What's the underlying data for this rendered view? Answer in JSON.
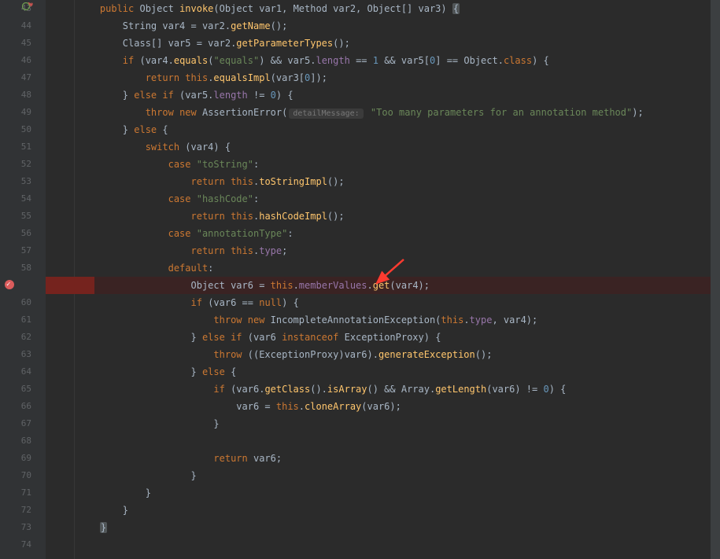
{
  "startLine": 43,
  "breakpointLine": 59,
  "lines": [
    {
      "indent": 1,
      "tokens": [
        {
          "t": "public ",
          "c": "kw"
        },
        {
          "t": "Object ",
          "c": "ty"
        },
        {
          "t": "invoke",
          "c": "fn"
        },
        {
          "t": "(Object var1, Method var2, Object[] var3) ",
          "c": "par"
        },
        {
          "t": "{",
          "c": "op",
          "caret": true
        }
      ]
    },
    {
      "indent": 2,
      "tokens": [
        {
          "t": "String var4 = var2.",
          "c": "par"
        },
        {
          "t": "getName",
          "c": "fn"
        },
        {
          "t": "();",
          "c": "op"
        }
      ]
    },
    {
      "indent": 2,
      "tokens": [
        {
          "t": "Class[] var5 = var2.",
          "c": "par"
        },
        {
          "t": "getParameterTypes",
          "c": "fn"
        },
        {
          "t": "();",
          "c": "op"
        }
      ]
    },
    {
      "indent": 2,
      "tokens": [
        {
          "t": "if ",
          "c": "kw"
        },
        {
          "t": "(var4.",
          "c": "par"
        },
        {
          "t": "equals",
          "c": "fn"
        },
        {
          "t": "(",
          "c": "op"
        },
        {
          "t": "\"equals\"",
          "c": "str"
        },
        {
          "t": ") && var5.",
          "c": "par"
        },
        {
          "t": "length",
          "c": "fld"
        },
        {
          "t": " == ",
          "c": "op"
        },
        {
          "t": "1",
          "c": "num"
        },
        {
          "t": " && var5[",
          "c": "par"
        },
        {
          "t": "0",
          "c": "num"
        },
        {
          "t": "] == Object.",
          "c": "par"
        },
        {
          "t": "class",
          "c": "kw"
        },
        {
          "t": ") {",
          "c": "op"
        }
      ]
    },
    {
      "indent": 3,
      "tokens": [
        {
          "t": "return ",
          "c": "kw"
        },
        {
          "t": "this",
          "c": "kw"
        },
        {
          "t": ".",
          "c": "op"
        },
        {
          "t": "equalsImpl",
          "c": "fn"
        },
        {
          "t": "(var3[",
          "c": "par"
        },
        {
          "t": "0",
          "c": "num"
        },
        {
          "t": "]);",
          "c": "op"
        }
      ]
    },
    {
      "indent": 2,
      "tokens": [
        {
          "t": "} ",
          "c": "op"
        },
        {
          "t": "else if ",
          "c": "kw"
        },
        {
          "t": "(var5.",
          "c": "par"
        },
        {
          "t": "length",
          "c": "fld"
        },
        {
          "t": " != ",
          "c": "op"
        },
        {
          "t": "0",
          "c": "num"
        },
        {
          "t": ") {",
          "c": "op"
        }
      ]
    },
    {
      "indent": 3,
      "tokens": [
        {
          "t": "throw ",
          "c": "kw"
        },
        {
          "t": "new ",
          "c": "kw"
        },
        {
          "t": "AssertionError",
          "c": "ty"
        },
        {
          "t": "(",
          "c": "op"
        },
        {
          "t": "detailMessage:",
          "hint": true
        },
        {
          "t": "\"Too many parameters for an annotation method\"",
          "c": "str"
        },
        {
          "t": ");",
          "c": "op"
        }
      ]
    },
    {
      "indent": 2,
      "tokens": [
        {
          "t": "} ",
          "c": "op"
        },
        {
          "t": "else ",
          "c": "kw"
        },
        {
          "t": "{",
          "c": "op"
        }
      ]
    },
    {
      "indent": 3,
      "tokens": [
        {
          "t": "switch ",
          "c": "kw"
        },
        {
          "t": "(var4) {",
          "c": "par"
        }
      ]
    },
    {
      "indent": 4,
      "tokens": [
        {
          "t": "case ",
          "c": "kw"
        },
        {
          "t": "\"toString\"",
          "c": "str"
        },
        {
          "t": ":",
          "c": "op"
        }
      ]
    },
    {
      "indent": 5,
      "tokens": [
        {
          "t": "return ",
          "c": "kw"
        },
        {
          "t": "this",
          "c": "kw"
        },
        {
          "t": ".",
          "c": "op"
        },
        {
          "t": "toStringImpl",
          "c": "fn"
        },
        {
          "t": "();",
          "c": "op"
        }
      ]
    },
    {
      "indent": 4,
      "tokens": [
        {
          "t": "case ",
          "c": "kw"
        },
        {
          "t": "\"hashCode\"",
          "c": "str"
        },
        {
          "t": ":",
          "c": "op"
        }
      ]
    },
    {
      "indent": 5,
      "tokens": [
        {
          "t": "return ",
          "c": "kw"
        },
        {
          "t": "this",
          "c": "kw"
        },
        {
          "t": ".",
          "c": "op"
        },
        {
          "t": "hashCodeImpl",
          "c": "fn"
        },
        {
          "t": "();",
          "c": "op"
        }
      ]
    },
    {
      "indent": 4,
      "tokens": [
        {
          "t": "case ",
          "c": "kw"
        },
        {
          "t": "\"annotationType\"",
          "c": "str"
        },
        {
          "t": ":",
          "c": "op"
        }
      ]
    },
    {
      "indent": 5,
      "tokens": [
        {
          "t": "return ",
          "c": "kw"
        },
        {
          "t": "this",
          "c": "kw"
        },
        {
          "t": ".",
          "c": "op"
        },
        {
          "t": "type",
          "c": "fld"
        },
        {
          "t": ";",
          "c": "op"
        }
      ]
    },
    {
      "indent": 4,
      "tokens": [
        {
          "t": "default",
          "c": "kw"
        },
        {
          "t": ":",
          "c": "op"
        }
      ]
    },
    {
      "indent": 5,
      "hl": true,
      "tokens": [
        {
          "t": "Object var6 = ",
          "c": "par"
        },
        {
          "t": "this",
          "c": "kw"
        },
        {
          "t": ".",
          "c": "op"
        },
        {
          "t": "memberValues",
          "c": "fld"
        },
        {
          "t": ".",
          "c": "op"
        },
        {
          "t": "get",
          "c": "fn"
        },
        {
          "t": "(var4);",
          "c": "par"
        }
      ]
    },
    {
      "indent": 5,
      "tokens": [
        {
          "t": "if ",
          "c": "kw"
        },
        {
          "t": "(var6 == ",
          "c": "par"
        },
        {
          "t": "null",
          "c": "kw"
        },
        {
          "t": ") {",
          "c": "op"
        }
      ]
    },
    {
      "indent": 6,
      "tokens": [
        {
          "t": "throw ",
          "c": "kw"
        },
        {
          "t": "new ",
          "c": "kw"
        },
        {
          "t": "IncompleteAnnotationException",
          "c": "ty"
        },
        {
          "t": "(",
          "c": "op"
        },
        {
          "t": "this",
          "c": "kw"
        },
        {
          "t": ".",
          "c": "op"
        },
        {
          "t": "type",
          "c": "fld"
        },
        {
          "t": ", var4);",
          "c": "par"
        }
      ]
    },
    {
      "indent": 5,
      "tokens": [
        {
          "t": "} ",
          "c": "op"
        },
        {
          "t": "else if ",
          "c": "kw"
        },
        {
          "t": "(var6 ",
          "c": "par"
        },
        {
          "t": "instanceof ",
          "c": "kw"
        },
        {
          "t": "ExceptionProxy",
          "c": "ty"
        },
        {
          "t": ") {",
          "c": "op"
        }
      ]
    },
    {
      "indent": 6,
      "tokens": [
        {
          "t": "throw ",
          "c": "kw"
        },
        {
          "t": "((",
          "c": "op"
        },
        {
          "t": "ExceptionProxy",
          "c": "ty"
        },
        {
          "t": ")var6).",
          "c": "par"
        },
        {
          "t": "generateException",
          "c": "fn"
        },
        {
          "t": "();",
          "c": "op"
        }
      ]
    },
    {
      "indent": 5,
      "tokens": [
        {
          "t": "} ",
          "c": "op"
        },
        {
          "t": "else ",
          "c": "kw"
        },
        {
          "t": "{",
          "c": "op"
        }
      ]
    },
    {
      "indent": 6,
      "tokens": [
        {
          "t": "if ",
          "c": "kw"
        },
        {
          "t": "(var6.",
          "c": "par"
        },
        {
          "t": "getClass",
          "c": "fn"
        },
        {
          "t": "().",
          "c": "op"
        },
        {
          "t": "isArray",
          "c": "fn"
        },
        {
          "t": "() && Array.",
          "c": "par"
        },
        {
          "t": "getLength",
          "c": "fn"
        },
        {
          "t": "(var6) != ",
          "c": "par"
        },
        {
          "t": "0",
          "c": "num"
        },
        {
          "t": ") {",
          "c": "op"
        }
      ]
    },
    {
      "indent": 7,
      "tokens": [
        {
          "t": "var6 = ",
          "c": "par"
        },
        {
          "t": "this",
          "c": "kw"
        },
        {
          "t": ".",
          "c": "op"
        },
        {
          "t": "cloneArray",
          "c": "fn"
        },
        {
          "t": "(var6);",
          "c": "par"
        }
      ]
    },
    {
      "indent": 6,
      "tokens": [
        {
          "t": "}",
          "c": "op"
        }
      ]
    },
    {
      "indent": 0,
      "tokens": []
    },
    {
      "indent": 6,
      "tokens": [
        {
          "t": "return ",
          "c": "kw"
        },
        {
          "t": "var6;",
          "c": "par"
        }
      ]
    },
    {
      "indent": 5,
      "tokens": [
        {
          "t": "}",
          "c": "op"
        }
      ]
    },
    {
      "indent": 3,
      "tokens": [
        {
          "t": "}",
          "c": "op"
        }
      ]
    },
    {
      "indent": 2,
      "tokens": [
        {
          "t": "}",
          "c": "op"
        }
      ]
    },
    {
      "indent": 1,
      "tokens": [
        {
          "t": "}",
          "c": "op",
          "caret": true
        }
      ]
    },
    {
      "indent": 0,
      "tokens": []
    }
  ]
}
